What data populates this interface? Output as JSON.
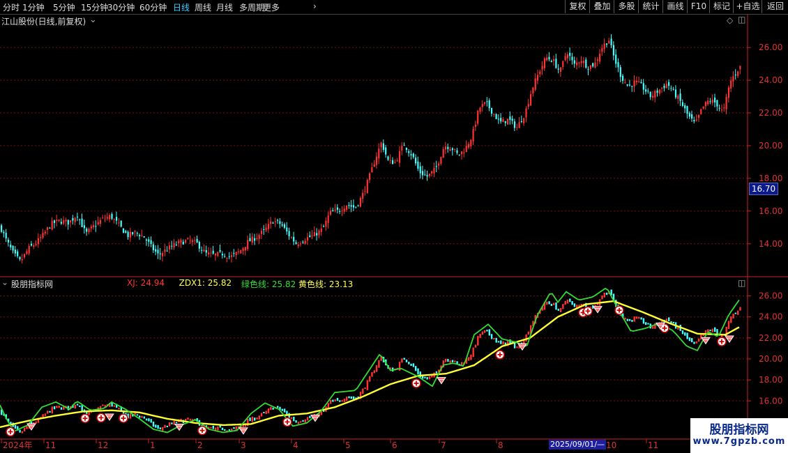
{
  "period_tabs": [
    "分时",
    "1分钟",
    "5分钟",
    "15分钟",
    "30分钟",
    "60分钟",
    "日线",
    "周线",
    "月线",
    "多周期",
    "更多"
  ],
  "active_tab": "日线",
  "tools": [
    "复权",
    "叠加",
    "多股",
    "统计",
    "画线",
    "F10",
    "标记",
    "+自选",
    "返回"
  ],
  "stock_title": "江山股份(日线,前复权)",
  "indicator_title": "股朋指标网",
  "indicator_values": [
    {
      "label": "XJ: 24.94",
      "color": "#ff3333"
    },
    {
      "label": "ZDX1: 25.82",
      "color": "#ffff55"
    },
    {
      "label": "绿色线: 25.82",
      "color": "#33dd33"
    },
    {
      "label": "黄色线: 23.13",
      "color": "#ffff55"
    }
  ],
  "current_price": "16.70",
  "cursor_date": "2025/09/01/—",
  "watermark": {
    "title": "股朋指标网",
    "url": "www.7gpzb.com"
  },
  "colors": {
    "up": "#ff3333",
    "down": "#44ffff",
    "grid": "#7a1010",
    "axis": "#cc2222",
    "yellow": "#ffff33",
    "green": "#33dd33"
  },
  "chart_data": [
    {
      "type": "candlestick",
      "title": "江山股份(日线,前复权)",
      "y_ticks": [
        14.0,
        16.0,
        18.0,
        20.0,
        22.0,
        24.0,
        26.0
      ],
      "ylim": [
        12.2,
        27.2
      ],
      "close_path": [
        [
          0,
          15.0
        ],
        [
          8,
          14.2
        ],
        [
          18,
          13.4
        ],
        [
          28,
          12.9
        ],
        [
          40,
          13.7
        ],
        [
          52,
          14.1
        ],
        [
          62,
          14.6
        ],
        [
          72,
          15.2
        ],
        [
          84,
          15.4
        ],
        [
          98,
          15.3
        ],
        [
          110,
          15.8
        ],
        [
          122,
          14.6
        ],
        [
          134,
          15.1
        ],
        [
          146,
          15.5
        ],
        [
          158,
          15.7
        ],
        [
          170,
          15.1
        ],
        [
          182,
          14.5
        ],
        [
          194,
          14.7
        ],
        [
          206,
          14.4
        ],
        [
          216,
          13.8
        ],
        [
          226,
          13.3
        ],
        [
          236,
          13.6
        ],
        [
          248,
          13.9
        ],
        [
          258,
          14.1
        ],
        [
          270,
          14.2
        ],
        [
          282,
          14.0
        ],
        [
          294,
          13.4
        ],
        [
          306,
          13.3
        ],
        [
          318,
          13.4
        ],
        [
          330,
          13.2
        ],
        [
          342,
          13.5
        ],
        [
          354,
          14.1
        ],
        [
          366,
          14.4
        ],
        [
          378,
          14.8
        ],
        [
          390,
          15.4
        ],
        [
          402,
          15.2
        ],
        [
          412,
          14.6
        ],
        [
          424,
          14.0
        ],
        [
          436,
          14.3
        ],
        [
          448,
          14.5
        ],
        [
          462,
          14.9
        ],
        [
          472,
          15.9
        ],
        [
          484,
          16.0
        ],
        [
          496,
          16.4
        ],
        [
          508,
          16.2
        ],
        [
          518,
          16.9
        ],
        [
          528,
          18.0
        ],
        [
          538,
          19.3
        ],
        [
          546,
          20.2
        ],
        [
          556,
          19.0
        ],
        [
          566,
          19.0
        ],
        [
          578,
          20.1
        ],
        [
          590,
          19.4
        ],
        [
          600,
          18.4
        ],
        [
          612,
          18.1
        ],
        [
          624,
          18.6
        ],
        [
          636,
          20.0
        ],
        [
          646,
          19.9
        ],
        [
          656,
          19.4
        ],
        [
          666,
          19.8
        ],
        [
          676,
          20.6
        ],
        [
          686,
          22.3
        ],
        [
          696,
          22.6
        ],
        [
          706,
          22.0
        ],
        [
          716,
          21.4
        ],
        [
          728,
          21.6
        ],
        [
          740,
          21.1
        ],
        [
          752,
          22.0
        ],
        [
          762,
          23.5
        ],
        [
          772,
          24.5
        ],
        [
          782,
          25.4
        ],
        [
          792,
          25.2
        ],
        [
          802,
          24.5
        ],
        [
          812,
          25.8
        ],
        [
          822,
          24.9
        ],
        [
          832,
          25.3
        ],
        [
          842,
          24.8
        ],
        [
          852,
          25.0
        ],
        [
          862,
          26.0
        ],
        [
          872,
          26.5
        ],
        [
          880,
          25.3
        ],
        [
          890,
          24.2
        ],
        [
          900,
          23.6
        ],
        [
          910,
          23.9
        ],
        [
          920,
          23.6
        ],
        [
          932,
          23.0
        ],
        [
          944,
          23.4
        ],
        [
          956,
          23.8
        ],
        [
          966,
          23.2
        ],
        [
          976,
          22.6
        ],
        [
          986,
          21.8
        ],
        [
          996,
          21.3
        ],
        [
          1006,
          22.3
        ],
        [
          1016,
          22.8
        ],
        [
          1026,
          22.6
        ],
        [
          1036,
          22.0
        ],
        [
          1046,
          23.9
        ],
        [
          1056,
          24.6
        ],
        [
          1062,
          24.9
        ]
      ]
    },
    {
      "type": "indicator",
      "title": "股朋指标网",
      "y_ticks": [
        16.0,
        18.0,
        20.0,
        22.0,
        24.0,
        26.0
      ],
      "ylim": [
        12.5,
        27.5
      ],
      "x_labels": [
        {
          "label": "2024年",
          "x": 2
        },
        {
          "label": "11",
          "x": 63
        },
        {
          "label": "12",
          "x": 138
        },
        {
          "label": "1",
          "x": 213
        },
        {
          "label": "2",
          "x": 281
        },
        {
          "label": "3",
          "x": 343
        },
        {
          "label": "4",
          "x": 418
        },
        {
          "label": "5",
          "x": 493
        },
        {
          "label": "6",
          "x": 560
        },
        {
          "label": "7",
          "x": 630
        },
        {
          "label": "8",
          "x": 712
        },
        {
          "label": "10",
          "x": 867
        },
        {
          "label": "11",
          "x": 927
        }
      ],
      "series": [
        {
          "name": "黄色线",
          "color": "#ffff33",
          "values": [
            [
              0,
              13.5
            ],
            [
              40,
              14.1
            ],
            [
              80,
              14.6
            ],
            [
              120,
              15.0
            ],
            [
              160,
              15.1
            ],
            [
              200,
              14.9
            ],
            [
              240,
              14.3
            ],
            [
              280,
              13.9
            ],
            [
              320,
              13.7
            ],
            [
              360,
              13.8
            ],
            [
              400,
              14.6
            ],
            [
              440,
              14.8
            ],
            [
              480,
              15.4
            ],
            [
              520,
              16.4
            ],
            [
              560,
              17.6
            ],
            [
              600,
              18.4
            ],
            [
              640,
              18.6
            ],
            [
              680,
              19.4
            ],
            [
              720,
              21.2
            ],
            [
              760,
              22.0
            ],
            [
              800,
              24.0
            ],
            [
              840,
              25.2
            ],
            [
              880,
              25.5
            ],
            [
              920,
              24.5
            ],
            [
              960,
              23.4
            ],
            [
              1000,
              22.4
            ],
            [
              1040,
              22.3
            ],
            [
              1062,
              23.1
            ]
          ]
        },
        {
          "name": "绿色线",
          "color": "#33dd33",
          "values": [
            [
              0,
              15.6
            ],
            [
              10,
              14.2
            ],
            [
              20,
              13.1
            ],
            [
              40,
              13.7
            ],
            [
              60,
              15.4
            ],
            [
              80,
              15.9
            ],
            [
              100,
              15.2
            ],
            [
              110,
              16.0
            ],
            [
              130,
              15.1
            ],
            [
              150,
              15.3
            ],
            [
              160,
              15.9
            ],
            [
              180,
              15.2
            ],
            [
              200,
              14.3
            ],
            [
              220,
              13.3
            ],
            [
              240,
              13.0
            ],
            [
              260,
              13.7
            ],
            [
              280,
              14.2
            ],
            [
              300,
              13.3
            ],
            [
              320,
              13.0
            ],
            [
              340,
              13.2
            ],
            [
              360,
              14.8
            ],
            [
              380,
              15.8
            ],
            [
              400,
              15.2
            ],
            [
              420,
              13.6
            ],
            [
              440,
              13.9
            ],
            [
              460,
              15.0
            ],
            [
              480,
              16.8
            ],
            [
              510,
              17.0
            ],
            [
              530,
              19.0
            ],
            [
              545,
              20.5
            ],
            [
              560,
              18.9
            ],
            [
              575,
              19.1
            ],
            [
              600,
              18.3
            ],
            [
              620,
              17.4
            ],
            [
              635,
              19.4
            ],
            [
              650,
              19.6
            ],
            [
              665,
              19.3
            ],
            [
              680,
              22.3
            ],
            [
              700,
              23.3
            ],
            [
              720,
              21.9
            ],
            [
              740,
              21.6
            ],
            [
              755,
              21.1
            ],
            [
              770,
              24.1
            ],
            [
              790,
              26.4
            ],
            [
              800,
              25.4
            ],
            [
              812,
              26.4
            ],
            [
              830,
              25.6
            ],
            [
              850,
              25.9
            ],
            [
              870,
              26.8
            ],
            [
              885,
              24.9
            ],
            [
              905,
              22.6
            ],
            [
              925,
              22.9
            ],
            [
              945,
              23.4
            ],
            [
              965,
              22.7
            ],
            [
              985,
              21.2
            ],
            [
              1000,
              20.8
            ],
            [
              1015,
              22.6
            ],
            [
              1030,
              22.1
            ],
            [
              1045,
              24.2
            ],
            [
              1062,
              25.8
            ]
          ]
        }
      ],
      "buy_marks_x": [
        15,
        122,
        145,
        177,
        290,
        412,
        597,
        717,
        836,
        843,
        888,
        953,
        1035
      ],
      "sell_marks_x": [
        45,
        157,
        257,
        349,
        452,
        633,
        749,
        857,
        947,
        1012,
        1046
      ]
    }
  ]
}
